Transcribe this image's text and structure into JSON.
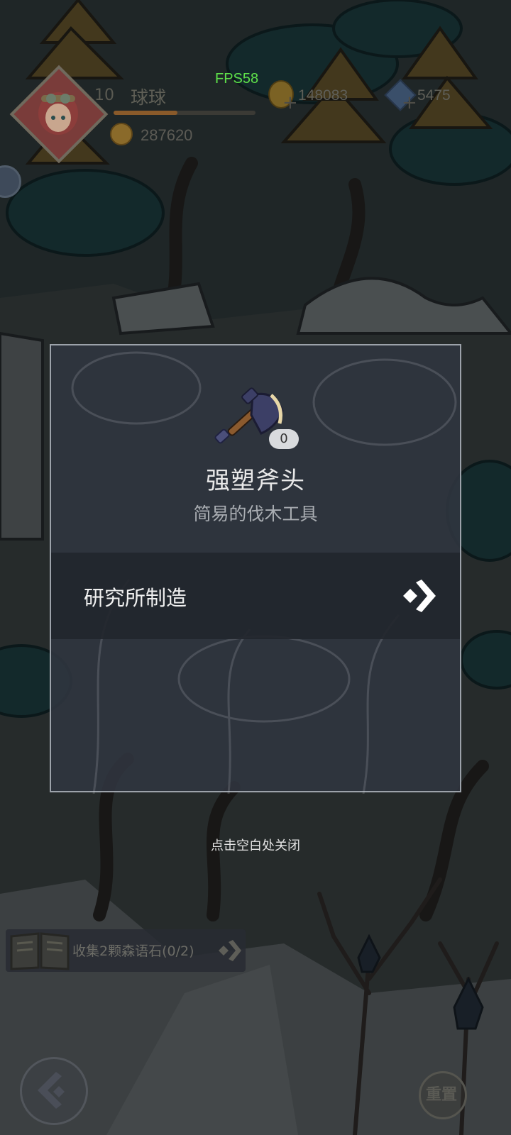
{
  "hud": {
    "fps": "FPS58",
    "player_level": "10",
    "player_name": "球球",
    "xp_fraction": 0.45,
    "power": "287620",
    "coins": "148083",
    "gems": "5475",
    "plus": "+"
  },
  "modal": {
    "item_count": "0",
    "item_name": "强塑斧头",
    "item_desc": "简易的伐木工具",
    "source_label": "研究所制造"
  },
  "close_hint": "点击空白处关闭",
  "quest": {
    "text": "收集2颗森语石(0/2)"
  },
  "reset_label": "重置",
  "colors": {
    "fps_green": "#5ee04a",
    "modal_bg": "#303640",
    "modal_border": "#9ca2aa",
    "source_row_bg": "#22262c"
  },
  "icons": {
    "avatar": "girl-with-goggles",
    "power": "medal-coin-icon",
    "coin": "gold-coin-icon",
    "gem": "blue-gem-icon",
    "item": "axe-icon",
    "source_arrow": "double-chevron-right-icon",
    "quest_book": "open-book-icon",
    "back": "back-arrow-icon",
    "reset": "reset-icon"
  }
}
